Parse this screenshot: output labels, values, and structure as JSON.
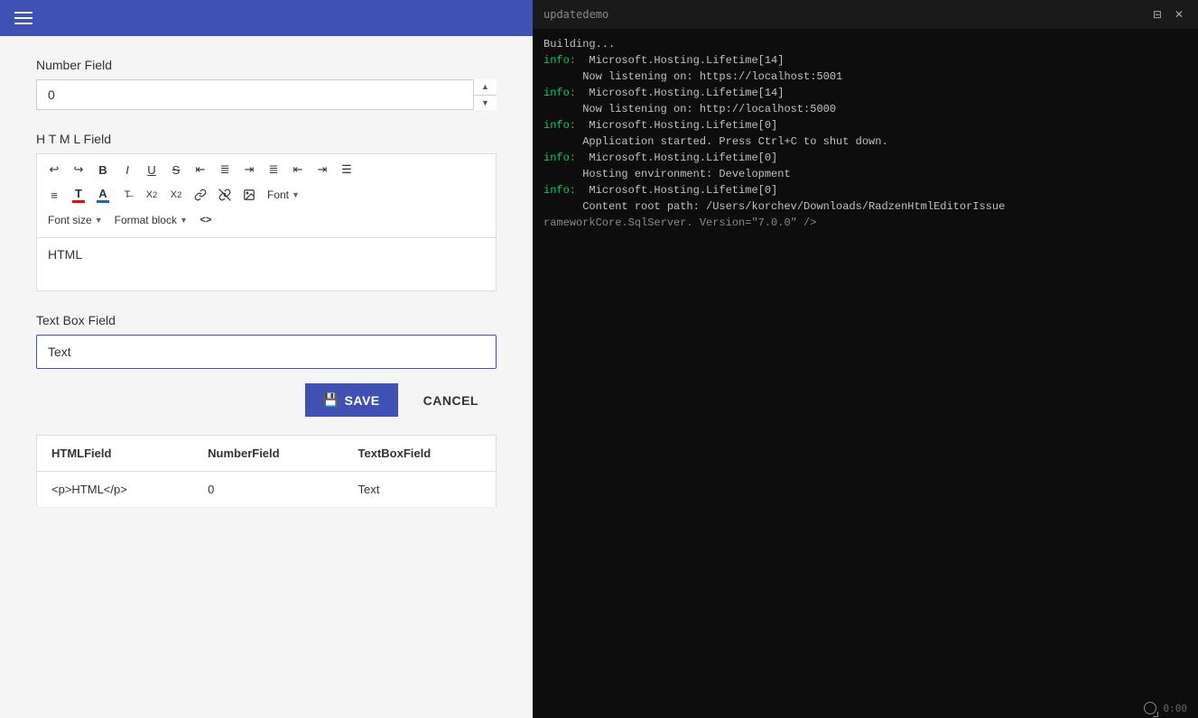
{
  "topBar": {
    "hamburgerLabel": "menu"
  },
  "numberField": {
    "label": "Number Field",
    "value": "0",
    "spinUp": "▲",
    "spinDown": "▼"
  },
  "htmlField": {
    "label": "H T M L Field",
    "content": "HTML",
    "toolbar": {
      "row1": [
        {
          "id": "undo",
          "symbol": "↩",
          "title": "Undo"
        },
        {
          "id": "redo",
          "symbol": "↪",
          "title": "Redo"
        },
        {
          "id": "bold",
          "symbol": "B",
          "title": "Bold"
        },
        {
          "id": "italic",
          "symbol": "I",
          "title": "Italic"
        },
        {
          "id": "underline",
          "symbol": "U",
          "title": "Underline"
        },
        {
          "id": "strike",
          "symbol": "S",
          "title": "Strikethrough"
        },
        {
          "id": "align-left",
          "symbol": "≡",
          "title": "Align Left"
        },
        {
          "id": "align-center",
          "symbol": "≡",
          "title": "Align Center"
        },
        {
          "id": "align-right",
          "symbol": "≡",
          "title": "Align Right"
        },
        {
          "id": "align-justify",
          "symbol": "≡",
          "title": "Justify"
        },
        {
          "id": "indent-left",
          "symbol": "⇤",
          "title": "Outdent"
        },
        {
          "id": "indent-right",
          "symbol": "⇥",
          "title": "Indent"
        },
        {
          "id": "list-unordered",
          "symbol": "≣",
          "title": "Unordered List"
        }
      ],
      "row2": [
        {
          "id": "list-ordered",
          "symbol": "≡#",
          "title": "Ordered List"
        },
        {
          "id": "font-color",
          "symbol": "A",
          "title": "Font Color",
          "color": "red"
        },
        {
          "id": "bg-color",
          "symbol": "A",
          "title": "Background Color",
          "color": "blue"
        },
        {
          "id": "remove-format",
          "symbol": "✕",
          "title": "Remove Format"
        },
        {
          "id": "subscript",
          "symbol": "X₂",
          "title": "Subscript"
        },
        {
          "id": "superscript",
          "symbol": "X²",
          "title": "Superscript"
        },
        {
          "id": "link",
          "symbol": "🔗",
          "title": "Insert Link"
        },
        {
          "id": "unlink",
          "symbol": "🔗✕",
          "title": "Unlink"
        },
        {
          "id": "image",
          "symbol": "🖼",
          "title": "Insert Image"
        }
      ],
      "fontDropdown": "Font",
      "fontSizeDropdown": "Font size",
      "formatBlockDropdown": "Format block",
      "sourceBtn": "<>"
    }
  },
  "textBoxField": {
    "label": "Text Box Field",
    "value": "Text",
    "placeholder": "Text"
  },
  "buttons": {
    "save": "SAVE",
    "cancel": "CANCEL"
  },
  "table": {
    "headers": [
      "HTMLField",
      "NumberField",
      "TextBoxField"
    ],
    "rows": [
      [
        "<p>HTML</p>",
        "0",
        "Text"
      ]
    ]
  },
  "terminal": {
    "title": "updatedemo",
    "lines": [
      {
        "type": "default",
        "text": "Building..."
      },
      {
        "type": "info",
        "prefix": "info:",
        "text": "  Microsoft.Hosting.Lifetime[14]"
      },
      {
        "type": "default",
        "text": "      Now listening on: https://localhost:5001"
      },
      {
        "type": "info",
        "prefix": "info:",
        "text": "  Microsoft.Hosting.Lifetime[14]"
      },
      {
        "type": "default",
        "text": "      Now listening on: http://localhost:5000"
      },
      {
        "type": "info",
        "prefix": "info:",
        "text": "  Microsoft.Hosting.Lifetime[0]"
      },
      {
        "type": "default",
        "text": "      Application started. Press Ctrl+C to shut down."
      },
      {
        "type": "info",
        "prefix": "info:",
        "text": "  Microsoft.Hosting.Lifetime[0]"
      },
      {
        "type": "default",
        "text": "      Hosting environment: Development"
      },
      {
        "type": "info",
        "prefix": "info:",
        "text": "  Microsoft.Hosting.Lifetime[0]"
      },
      {
        "type": "default",
        "text": "      Content root path: /Users/korchev/Downloads/RadzenHtmlEditorIssue"
      },
      {
        "type": "partial",
        "prefix": "        ",
        "text": "rameworkCore.SqlServer. Version=\"7.0.0\" />"
      }
    ],
    "time": "0:00"
  }
}
